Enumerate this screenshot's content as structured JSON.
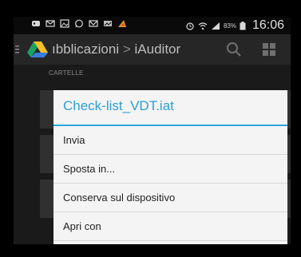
{
  "status_bar": {
    "battery_percent": "83%",
    "time": "16:06",
    "icons": [
      "notification-icon",
      "mail-icon",
      "image-icon",
      "whatsapp-icon",
      "gmail-icon",
      "gallery-icon",
      "pizza-icon",
      "alarm-icon",
      "wifi-icon",
      "signal-icon",
      "battery-icon"
    ]
  },
  "app_bar": {
    "title_part1": "ıbblicazioni",
    "separator": ">",
    "title_part2": "iAuditor",
    "icons": [
      "menu-icon",
      "drive-icon",
      "search-icon",
      "grid-icon"
    ]
  },
  "section_label": "CARTELLE",
  "dialog": {
    "title": "Check-list_VDT.iat",
    "items": [
      {
        "label": "Invia"
      },
      {
        "label": "Sposta in..."
      },
      {
        "label": "Conserva sul dispositivo"
      },
      {
        "label": "Apri con"
      }
    ]
  },
  "colors": {
    "accent": "#2a9fd6",
    "dialog_background": "#f4f4f4",
    "app_bar": "#262626",
    "status_bar": "#0a0a0a"
  }
}
